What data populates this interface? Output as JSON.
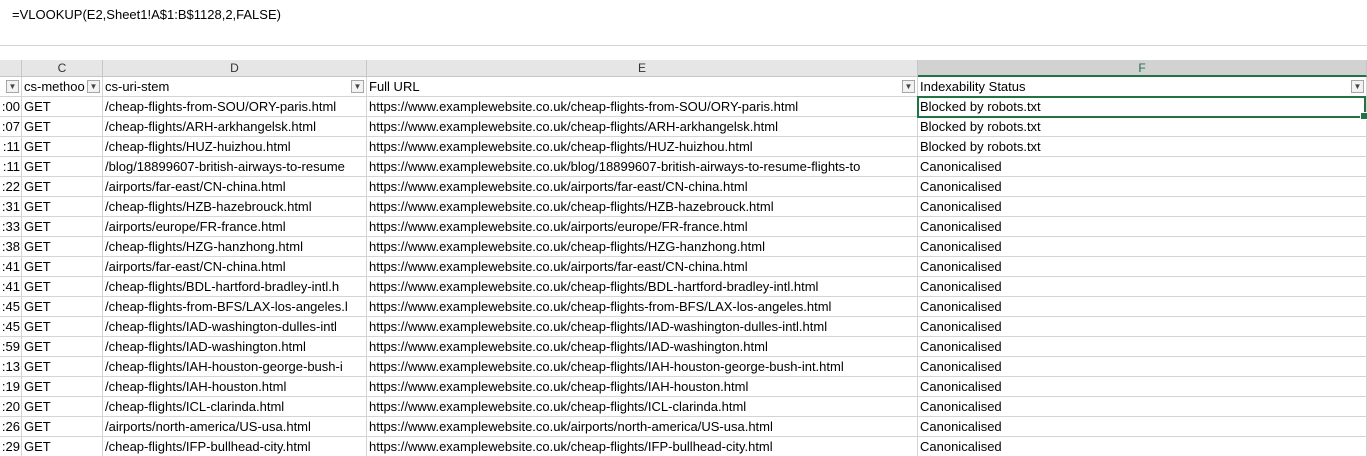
{
  "formula_bar": {
    "formula": "=VLOOKUP(E2,Sheet1!A$1:B$1128,2,FALSE)"
  },
  "column_headers": [
    "C",
    "D",
    "E",
    "F"
  ],
  "header_row": {
    "b": "",
    "c": "cs-methoo",
    "d": "cs-uri-stem",
    "e": "Full URL",
    "f": "Indexability Status"
  },
  "rows": [
    {
      "time": ":00",
      "method": "GET",
      "stem": "/cheap-flights-from-SOU/ORY-paris.html",
      "url": "https://www.examplewebsite.co.uk/cheap-flights-from-SOU/ORY-paris.html",
      "status": "Blocked by robots.txt"
    },
    {
      "time": ":07",
      "method": "GET",
      "stem": "/cheap-flights/ARH-arkhangelsk.html",
      "url": "https://www.examplewebsite.co.uk/cheap-flights/ARH-arkhangelsk.html",
      "status": "Blocked by robots.txt"
    },
    {
      "time": ":11",
      "method": "GET",
      "stem": "/cheap-flights/HUZ-huizhou.html",
      "url": "https://www.examplewebsite.co.uk/cheap-flights/HUZ-huizhou.html",
      "status": "Blocked by robots.txt"
    },
    {
      "time": ":11",
      "method": "GET",
      "stem": "/blog/18899607-british-airways-to-resume",
      "url": "https://www.examplewebsite.co.uk/blog/18899607-british-airways-to-resume-flights-to",
      "status": "Canonicalised"
    },
    {
      "time": ":22",
      "method": "GET",
      "stem": "/airports/far-east/CN-china.html",
      "url": "https://www.examplewebsite.co.uk/airports/far-east/CN-china.html",
      "status": "Canonicalised"
    },
    {
      "time": ":31",
      "method": "GET",
      "stem": "/cheap-flights/HZB-hazebrouck.html",
      "url": "https://www.examplewebsite.co.uk/cheap-flights/HZB-hazebrouck.html",
      "status": "Canonicalised"
    },
    {
      "time": ":33",
      "method": "GET",
      "stem": "/airports/europe/FR-france.html",
      "url": "https://www.examplewebsite.co.uk/airports/europe/FR-france.html",
      "status": "Canonicalised"
    },
    {
      "time": ":38",
      "method": "GET",
      "stem": "/cheap-flights/HZG-hanzhong.html",
      "url": "https://www.examplewebsite.co.uk/cheap-flights/HZG-hanzhong.html",
      "status": "Canonicalised"
    },
    {
      "time": ":41",
      "method": "GET",
      "stem": "/airports/far-east/CN-china.html",
      "url": "https://www.examplewebsite.co.uk/airports/far-east/CN-china.html",
      "status": "Canonicalised"
    },
    {
      "time": ":41",
      "method": "GET",
      "stem": "/cheap-flights/BDL-hartford-bradley-intl.h",
      "url": "https://www.examplewebsite.co.uk/cheap-flights/BDL-hartford-bradley-intl.html",
      "status": "Canonicalised"
    },
    {
      "time": ":45",
      "method": "GET",
      "stem": "/cheap-flights-from-BFS/LAX-los-angeles.l",
      "url": "https://www.examplewebsite.co.uk/cheap-flights-from-BFS/LAX-los-angeles.html",
      "status": "Canonicalised"
    },
    {
      "time": ":45",
      "method": "GET",
      "stem": "/cheap-flights/IAD-washington-dulles-intl",
      "url": "https://www.examplewebsite.co.uk/cheap-flights/IAD-washington-dulles-intl.html",
      "status": "Canonicalised"
    },
    {
      "time": ":59",
      "method": "GET",
      "stem": "/cheap-flights/IAD-washington.html",
      "url": "https://www.examplewebsite.co.uk/cheap-flights/IAD-washington.html",
      "status": "Canonicalised"
    },
    {
      "time": ":13",
      "method": "GET",
      "stem": "/cheap-flights/IAH-houston-george-bush-i",
      "url": "https://www.examplewebsite.co.uk/cheap-flights/IAH-houston-george-bush-int.html",
      "status": "Canonicalised"
    },
    {
      "time": ":19",
      "method": "GET",
      "stem": "/cheap-flights/IAH-houston.html",
      "url": "https://www.examplewebsite.co.uk/cheap-flights/IAH-houston.html",
      "status": "Canonicalised"
    },
    {
      "time": ":20",
      "method": "GET",
      "stem": "/cheap-flights/ICL-clarinda.html",
      "url": "https://www.examplewebsite.co.uk/cheap-flights/ICL-clarinda.html",
      "status": "Canonicalised"
    },
    {
      "time": ":26",
      "method": "GET",
      "stem": "/airports/north-america/US-usa.html",
      "url": "https://www.examplewebsite.co.uk/airports/north-america/US-usa.html",
      "status": "Canonicalised"
    },
    {
      "time": ":29",
      "method": "GET",
      "stem": "/cheap-flights/IFP-bullhead-city.html",
      "url": "https://www.examplewebsite.co.uk/cheap-flights/IFP-bullhead-city.html",
      "status": "Canonicalised"
    }
  ],
  "icons": {
    "filter_dropdown": "chevron-down-icon",
    "filter_active": "filter-icon"
  },
  "colors": {
    "accent": "#217346",
    "header_bg": "#e6e6e6",
    "gridline": "#d4d4d4"
  }
}
